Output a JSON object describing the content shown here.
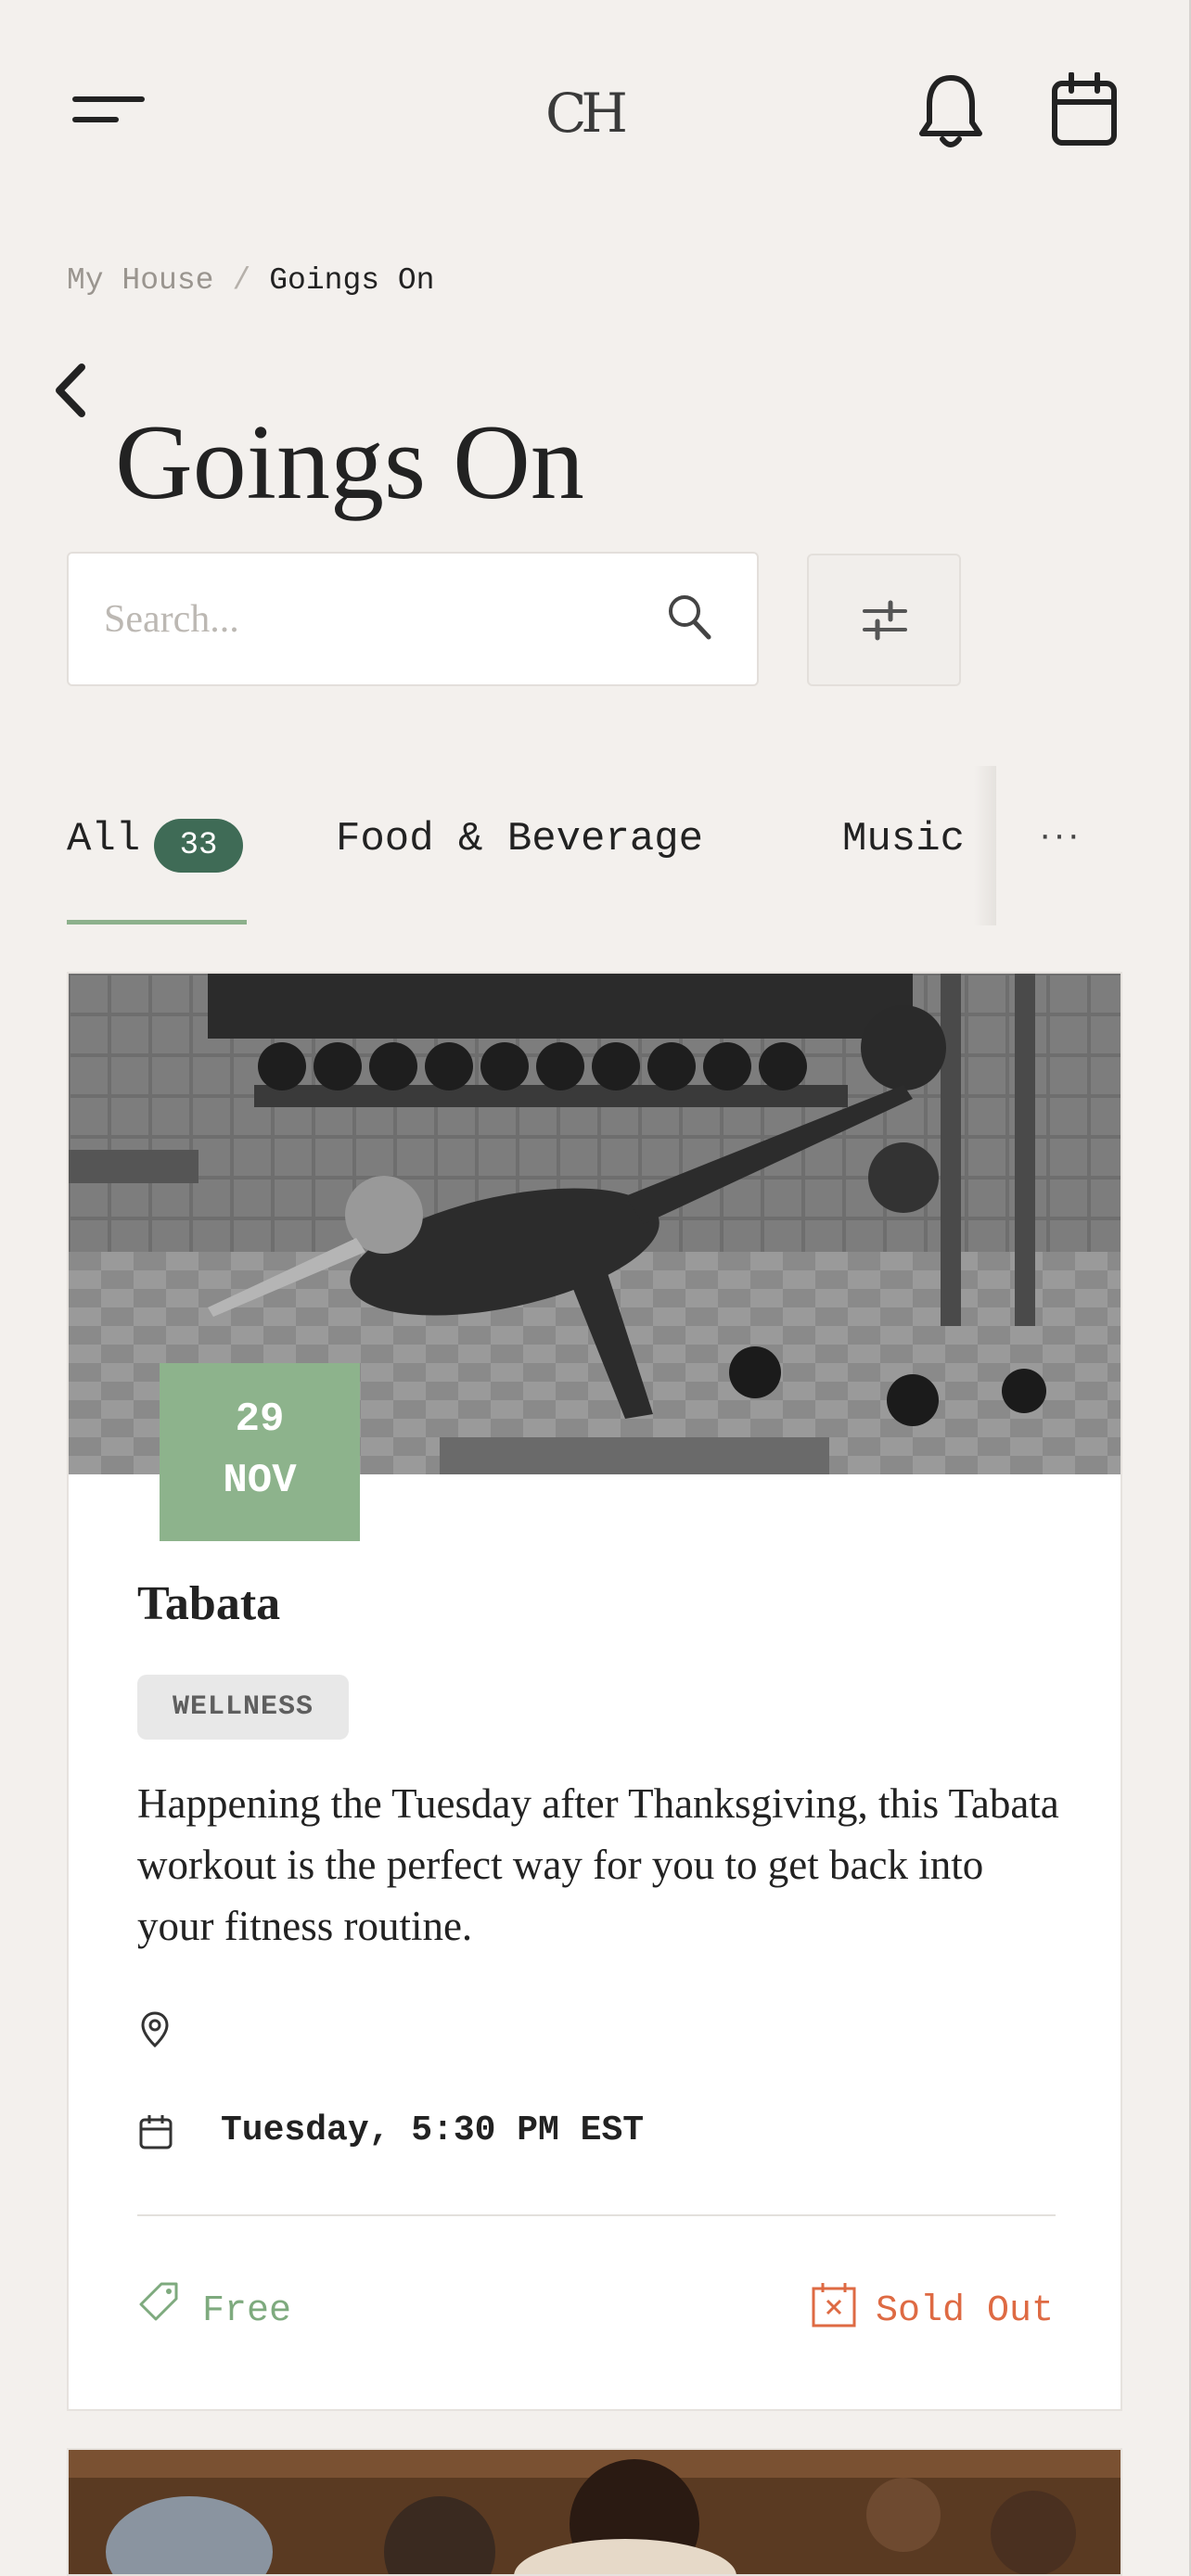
{
  "header": {
    "logo_text": "CH",
    "menu_icon": "menu-icon",
    "notifications_icon": "bell-icon",
    "calendar_icon": "calendar-icon"
  },
  "breadcrumb": {
    "items": [
      "My House",
      "Goings On"
    ],
    "separator": "/"
  },
  "page": {
    "title": "Goings On",
    "back_icon": "chevron-left-icon"
  },
  "search": {
    "placeholder": "Search...",
    "value": "",
    "icon": "search-icon",
    "filter_icon": "sliders-icon"
  },
  "tabs": [
    {
      "label": "All",
      "count": "33",
      "active": true
    },
    {
      "label": "Food & Beverage",
      "active": false
    },
    {
      "label": "Music",
      "active": false
    }
  ],
  "tabs_more_label": "···",
  "events": [
    {
      "date_day": "29",
      "date_month": "NOV",
      "title": "Tabata",
      "tag": "WELLNESS",
      "description": "Happening the Tuesday after Thanksgiving, this Tabata workout is the perfect way for you to get back into your fitness routine.",
      "location": "",
      "time": "Tuesday, 5:30 PM EST",
      "price": "Free",
      "availability": "Sold Out"
    }
  ],
  "colors": {
    "background": "#f3f0ed",
    "accent_green": "#8db38c",
    "badge_green": "#3f6b56",
    "sold_out": "#de6a43"
  }
}
